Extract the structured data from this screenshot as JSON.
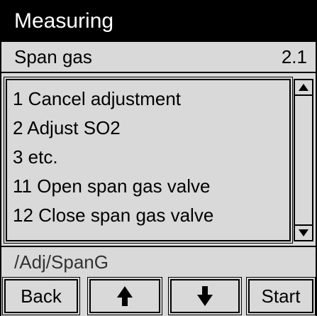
{
  "header": {
    "title": "Measuring"
  },
  "subheader": {
    "label": "Span gas",
    "version": "2.1"
  },
  "menu": {
    "items": [
      {
        "label": "1 Cancel adjustment"
      },
      {
        "label": "2 Adjust SO2"
      },
      {
        "label": "3 etc."
      },
      {
        "label": "11 Open span gas valve"
      },
      {
        "label": "12 Close span gas valve"
      }
    ]
  },
  "path": {
    "text": "/Adj/SpanG"
  },
  "softkeys": {
    "back_label": "Back",
    "up_icon": "arrow-up-icon",
    "down_icon": "arrow-down-icon",
    "start_label": "Start"
  }
}
